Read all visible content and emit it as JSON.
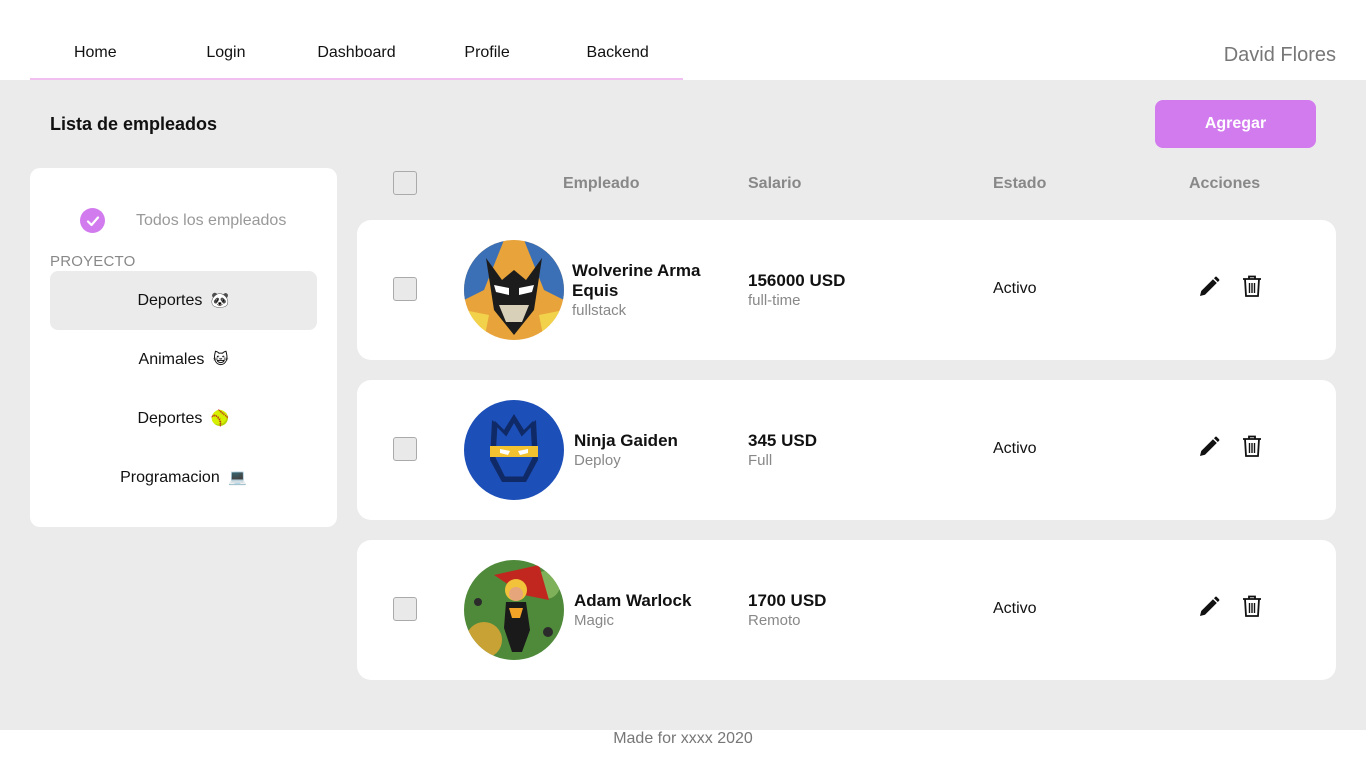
{
  "nav": {
    "items": [
      "Home",
      "Login",
      "Dashboard",
      "Profile",
      "Backend"
    ],
    "user_name": "David Flores"
  },
  "page": {
    "title": "Lista de empleados",
    "add_label": "Agregar"
  },
  "sidebar": {
    "all_label": "Todos los empleados",
    "section_label": "PROYECTO",
    "projects": [
      {
        "label": "Deportes",
        "emoji": "🐼"
      },
      {
        "label": "Animales",
        "emoji": "😺"
      },
      {
        "label": "Deportes",
        "emoji": "🥎"
      },
      {
        "label": "Programacion",
        "emoji": "💻"
      }
    ]
  },
  "table": {
    "headers": {
      "employee": "Empleado",
      "salary": "Salario",
      "status": "Estado",
      "actions": "Acciones"
    },
    "rows": [
      {
        "name": "Wolverine Arma Equis",
        "role": "fullstack",
        "salary": "156000 USD",
        "type": "full-time",
        "status": "Activo"
      },
      {
        "name": "Ninja Gaiden",
        "role": "Deploy",
        "salary": "345 USD",
        "type": "Full",
        "status": "Activo"
      },
      {
        "name": "Adam Warlock",
        "role": "Magic",
        "salary": "1700 USD",
        "type": "Remoto",
        "status": "Activo"
      }
    ]
  },
  "footer": {
    "text": "Made for xxxx 2020"
  },
  "colors": {
    "accent": "#d27bee",
    "nav_underline": "#f1bff0",
    "background": "#ebebeb"
  },
  "icons": [
    "check-icon",
    "edit-pencil-icon",
    "trash-icon"
  ]
}
